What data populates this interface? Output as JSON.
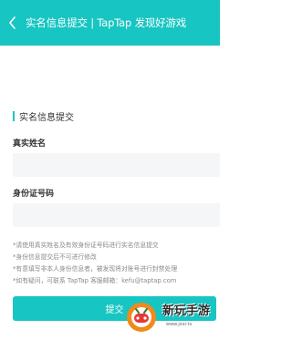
{
  "header": {
    "back_icon": "chevron-left-icon",
    "title": "实名信息提交 | TapTap 发现好游戏",
    "background_color": "#17c5c2"
  },
  "form": {
    "section_title": "实名信息提交",
    "name_label": "真实姓名",
    "name_value": "",
    "id_label": "身份证号码",
    "id_value": ""
  },
  "notes": [
    "*请使用真实姓名及有效身份证号码进行实名信息提交",
    "*身份信息提交后不可进行修改",
    "*有意填写非本人身份信息者，被发现将对账号进行封禁处理",
    "*如有疑问，可联系 TapTap 客服邮箱：kefu@taptap.com"
  ],
  "submit": {
    "label": "提交"
  },
  "watermark": {
    "text": "新玩手游",
    "url": "www.jxsr.tv"
  }
}
